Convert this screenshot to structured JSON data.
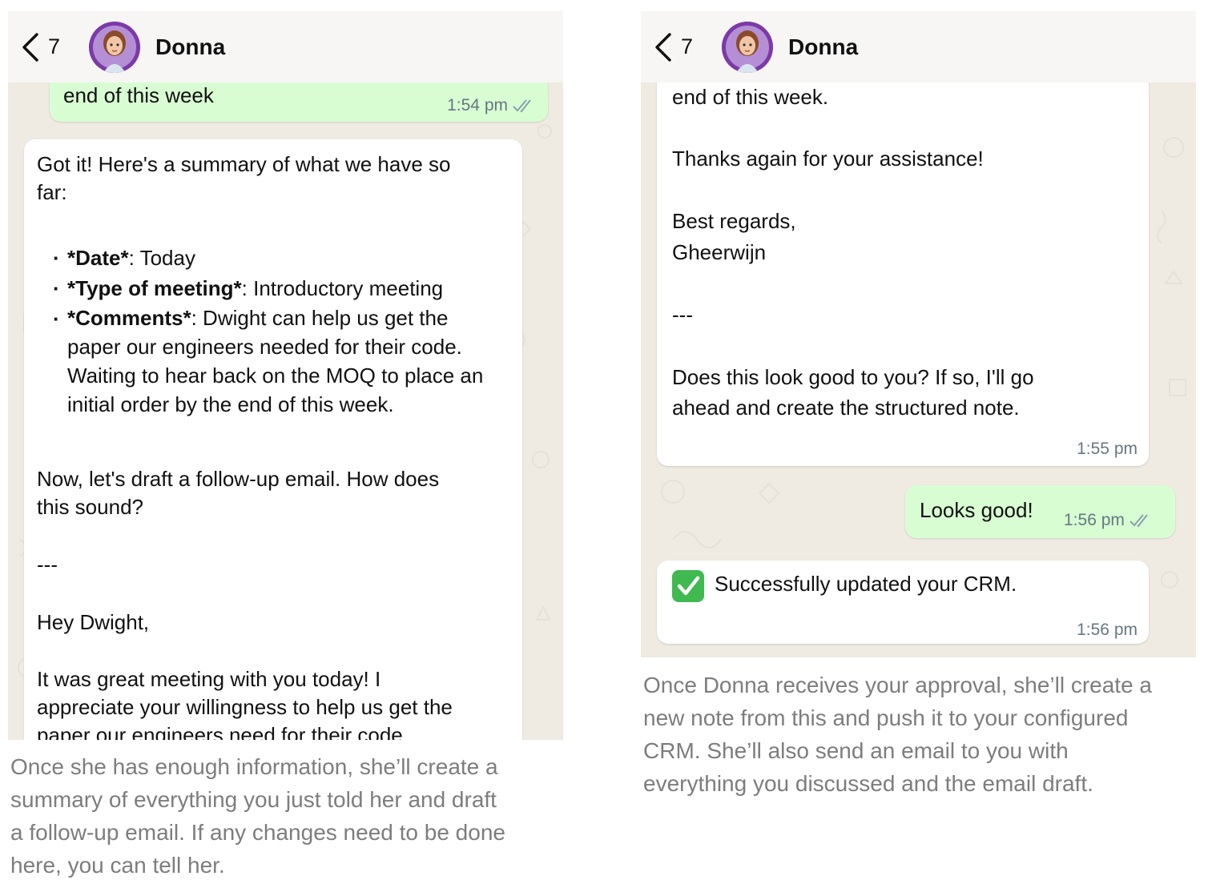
{
  "left_panel": {
    "header": {
      "back_count": "7",
      "contact_name": "Donna"
    },
    "sent_fragment": {
      "text": "end of this week",
      "time": "1:54 pm"
    },
    "summary_message": {
      "intro_lines": [
        "Got it! Here's a summary of what we have so",
        "far:"
      ],
      "bullets": [
        {
          "bold": "*Date*",
          "rest": ": Today"
        },
        {
          "bold": "*Type of meeting*",
          "rest": ": Introductory meeting"
        },
        {
          "bold": "*Comments*",
          "rest": ": Dwight can help us get the",
          "more": [
            "paper our engineers needed for their code.",
            "Waiting to hear back on the MOQ to place an",
            "initial order by the end of this week."
          ]
        }
      ],
      "draft_lines": [
        "Now, let's draft a follow-up email. How does",
        "this sound?"
      ],
      "separator": "---",
      "greeting": "Hey Dwight,",
      "body_lines": [
        "It was great meeting with you today! I",
        "appreciate your willingness to help us get the",
        "paper our engineers need for their code."
      ]
    },
    "caption_lines": [
      "Once she has enough information, she’ll create a",
      "summary of everything you just told her and draft",
      "a follow-up email. If any changes need to be done",
      "here, you can tell her."
    ]
  },
  "right_panel": {
    "header": {
      "back_count": "7",
      "contact_name": "Donna"
    },
    "email_tail": {
      "line1": "end of this week.",
      "thanks": "Thanks again for your assistance!",
      "regards": "Best regards,",
      "signature": "Gheerwijn",
      "separator": "---",
      "question_lines": [
        "Does this look good to you? If so, I'll go",
        "ahead and create the structured note."
      ],
      "time": "1:55 pm"
    },
    "reply": {
      "text": "Looks good!",
      "time": "1:56 pm"
    },
    "confirmation": {
      "text": "Successfully updated your CRM.",
      "time": "1:56 pm"
    },
    "caption_lines": [
      "Once Donna receives your approval, she’ll create a",
      "new note from this and push it to your configured",
      "CRM. She’ll also send an email to you with",
      "everything you discussed and the email draft."
    ]
  },
  "colors": {
    "chat_background": "#efeae2",
    "header_background": "#f7f6f4",
    "incoming_bubble": "#ffffff",
    "outgoing_bubble": "#d9fdd3",
    "read_ticks": "#8aa0ad",
    "avatar_ring": "#7c3aa8",
    "caption_text": "#7d7d7d"
  },
  "icons": [
    "chevron-left-icon",
    "double-check-icon",
    "check-mark-emoji-icon",
    "avatar-image"
  ]
}
